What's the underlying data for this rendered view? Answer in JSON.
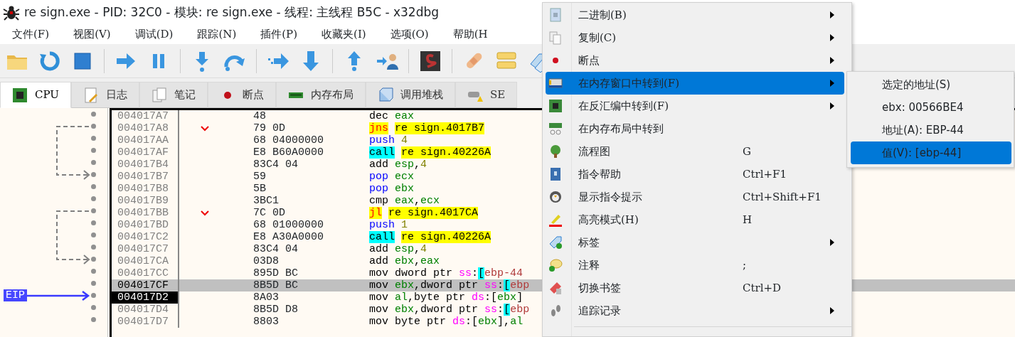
{
  "window": {
    "title": "re sign.exe - PID: 32C0 - 模块: re sign.exe - 线程: 主线程 B5C - x32dbg"
  },
  "menu_bar": [
    "文件(F)",
    "视图(V)",
    "调试(D)",
    "跟踪(N)",
    "插件(P)",
    "收藏夹(I)",
    "选项(O)",
    "帮助(H"
  ],
  "tabs": [
    {
      "label": "CPU",
      "selected": true
    },
    {
      "label": "日志",
      "selected": false
    },
    {
      "label": "笔记",
      "selected": false
    },
    {
      "label": "断点",
      "selected": false
    },
    {
      "label": "内存布局",
      "selected": false
    },
    {
      "label": "调用堆栈",
      "selected": false
    },
    {
      "label": "SE",
      "selected": false
    }
  ],
  "disassembly": {
    "rows": [
      {
        "address": "004017A7",
        "bytes": "48",
        "selected": false,
        "instruction": [
          {
            "text": "dec",
            "kind": "op"
          },
          {
            "text": "eax",
            "kind": "reg",
            "spaced": true
          }
        ]
      },
      {
        "address": "004017A8",
        "bytes": "79 0D",
        "selected": false,
        "branch_source": true,
        "instruction": [
          {
            "text": "jns",
            "kind": "jcc"
          },
          {
            "text": "re sign.4017B7",
            "kind": "addr",
            "spaced": true
          }
        ]
      },
      {
        "address": "004017AA",
        "bytes": "68 04000000",
        "selected": false,
        "instruction": [
          {
            "text": "push",
            "kind": "stack"
          },
          {
            "text": "4",
            "kind": "num",
            "spaced": true
          }
        ]
      },
      {
        "address": "004017AF",
        "bytes": "E8 B60A0000",
        "selected": false,
        "instruction": [
          {
            "text": "call",
            "kind": "call"
          },
          {
            "text": "re sign.40226A",
            "kind": "addr",
            "spaced": true
          }
        ]
      },
      {
        "address": "004017B4",
        "bytes": "83C4 04",
        "selected": false,
        "instruction": [
          {
            "text": "add",
            "kind": "op"
          },
          {
            "text": "esp",
            "kind": "reg",
            "spaced": true
          },
          {
            "text": ",",
            "kind": "text"
          },
          {
            "text": "4",
            "kind": "num"
          }
        ]
      },
      {
        "address": "004017B7",
        "bytes": "59",
        "selected": false,
        "branch_target": true,
        "instruction": [
          {
            "text": "pop",
            "kind": "stack"
          },
          {
            "text": "ecx",
            "kind": "reg",
            "spaced": true
          }
        ]
      },
      {
        "address": "004017B8",
        "bytes": "5B",
        "selected": false,
        "instruction": [
          {
            "text": "pop",
            "kind": "stack"
          },
          {
            "text": "ebx",
            "kind": "reg",
            "spaced": true
          }
        ]
      },
      {
        "address": "004017B9",
        "bytes": "3BC1",
        "selected": false,
        "instruction": [
          {
            "text": "cmp",
            "kind": "op"
          },
          {
            "text": "eax",
            "kind": "reg",
            "spaced": true
          },
          {
            "text": ",",
            "kind": "text"
          },
          {
            "text": "ecx",
            "kind": "reg"
          }
        ]
      },
      {
        "address": "004017BB",
        "bytes": "7C 0D",
        "selected": false,
        "branch_source": true,
        "instruction": [
          {
            "text": "jl",
            "kind": "jcc"
          },
          {
            "text": "re sign.4017CA",
            "kind": "addr",
            "spaced": true
          }
        ]
      },
      {
        "address": "004017BD",
        "bytes": "68 01000000",
        "selected": false,
        "instruction": [
          {
            "text": "push",
            "kind": "stack"
          },
          {
            "text": "1",
            "kind": "num",
            "spaced": true
          }
        ]
      },
      {
        "address": "004017C2",
        "bytes": "E8 A30A0000",
        "selected": false,
        "instruction": [
          {
            "text": "call",
            "kind": "call"
          },
          {
            "text": "re sign.40226A",
            "kind": "addr",
            "spaced": true
          }
        ]
      },
      {
        "address": "004017C7",
        "bytes": "83C4 04",
        "selected": false,
        "instruction": [
          {
            "text": "add",
            "kind": "op"
          },
          {
            "text": "esp",
            "kind": "reg",
            "spaced": true
          },
          {
            "text": ",",
            "kind": "text"
          },
          {
            "text": "4",
            "kind": "num"
          }
        ]
      },
      {
        "address": "004017CA",
        "bytes": "03D8",
        "selected": false,
        "branch_target": true,
        "instruction": [
          {
            "text": "add",
            "kind": "op"
          },
          {
            "text": "ebx",
            "kind": "reg",
            "spaced": true
          },
          {
            "text": ",",
            "kind": "text"
          },
          {
            "text": "eax",
            "kind": "reg"
          }
        ]
      },
      {
        "address": "004017CC",
        "bytes": "895D BC",
        "selected": false,
        "instruction": [
          {
            "text": "mov",
            "kind": "op"
          },
          {
            "text": "dword ptr",
            "kind": "text",
            "spaced": true
          },
          {
            "text": "ss",
            "kind": "seg",
            "spaced": true
          },
          {
            "text": ":",
            "kind": "text"
          },
          {
            "text": "[",
            "kind": "brk"
          },
          {
            "text": "ebp-44",
            "kind": "mem"
          }
        ]
      },
      {
        "address": "004017CF",
        "bytes": "8B5D BC",
        "selected": true,
        "instruction": [
          {
            "text": "mov",
            "kind": "op"
          },
          {
            "text": "ebx",
            "kind": "reg",
            "spaced": true
          },
          {
            "text": ",dword ptr",
            "kind": "text"
          },
          {
            "text": "ss",
            "kind": "seg",
            "spaced": true
          },
          {
            "text": ":",
            "kind": "text"
          },
          {
            "text": "[",
            "kind": "brk"
          },
          {
            "text": "ebp",
            "kind": "mem"
          }
        ]
      },
      {
        "address": "004017D2",
        "bytes": "8A03",
        "selected": false,
        "marker": "EIP",
        "instruction": [
          {
            "text": "mov",
            "kind": "op"
          },
          {
            "text": "al",
            "kind": "reg",
            "spaced": true
          },
          {
            "text": ",byte ptr",
            "kind": "text"
          },
          {
            "text": "ds",
            "kind": "seg",
            "spaced": true
          },
          {
            "text": ":[",
            "kind": "text"
          },
          {
            "text": "ebx",
            "kind": "reg"
          },
          {
            "text": "]",
            "kind": "text"
          }
        ]
      },
      {
        "address": "004017D4",
        "bytes": "8B5D D8",
        "selected": false,
        "instruction": [
          {
            "text": "mov",
            "kind": "op"
          },
          {
            "text": "ebx",
            "kind": "reg",
            "spaced": true
          },
          {
            "text": ",dword ptr",
            "kind": "text"
          },
          {
            "text": "ss",
            "kind": "seg",
            "spaced": true
          },
          {
            "text": ":",
            "kind": "text"
          },
          {
            "text": "[",
            "kind": "brk"
          },
          {
            "text": "ebp",
            "kind": "mem"
          }
        ]
      },
      {
        "address": "004017D7",
        "bytes": "8803",
        "selected": false,
        "instruction": [
          {
            "text": "mov",
            "kind": "op"
          },
          {
            "text": "byte ptr",
            "kind": "text",
            "spaced": true
          },
          {
            "text": "ds",
            "kind": "seg",
            "spaced": true
          },
          {
            "text": ":[",
            "kind": "text"
          },
          {
            "text": "ebx",
            "kind": "reg"
          },
          {
            "text": "],",
            "kind": "text"
          },
          {
            "text": "al",
            "kind": "reg"
          }
        ]
      }
    ]
  },
  "context_menu": {
    "items": [
      {
        "label": "二进制(B)",
        "submenu": true,
        "selected": false
      },
      {
        "label": "复制(C)",
        "submenu": true,
        "selected": false
      },
      {
        "label": "断点",
        "submenu": true,
        "selected": false
      },
      {
        "label": "在内存窗口中转到(F)",
        "submenu": true,
        "selected": true
      },
      {
        "label": "在反汇编中转到(F)",
        "submenu": true,
        "selected": false
      },
      {
        "label": "在内存布局中转到",
        "submenu": false,
        "selected": false
      },
      {
        "label": "流程图",
        "shortcut": "G",
        "submenu": false,
        "selected": false
      },
      {
        "label": "指令帮助",
        "shortcut": "Ctrl+F1",
        "submenu": false,
        "selected": false
      },
      {
        "label": "显示指令提示",
        "shortcut": "Ctrl+Shift+F1",
        "submenu": false,
        "selected": false
      },
      {
        "label": "高亮模式(H)",
        "shortcut": "H",
        "submenu": false,
        "selected": false
      },
      {
        "label": "标签",
        "submenu": true,
        "selected": false
      },
      {
        "label": "注释",
        "shortcut": ";",
        "submenu": false,
        "selected": false
      },
      {
        "label": "切换书签",
        "shortcut": "Ctrl+D",
        "submenu": false,
        "selected": false
      },
      {
        "label": "追踪记录",
        "submenu": true,
        "selected": false
      }
    ]
  },
  "submenu": {
    "items": [
      {
        "label": "选定的地址(S)",
        "selected": false
      },
      {
        "label": "ebx: 00566BE4",
        "selected": false
      },
      {
        "label": "地址(A): EBP-44",
        "selected": false
      },
      {
        "label": "值(V): [ebp-44]",
        "selected": true
      }
    ]
  }
}
